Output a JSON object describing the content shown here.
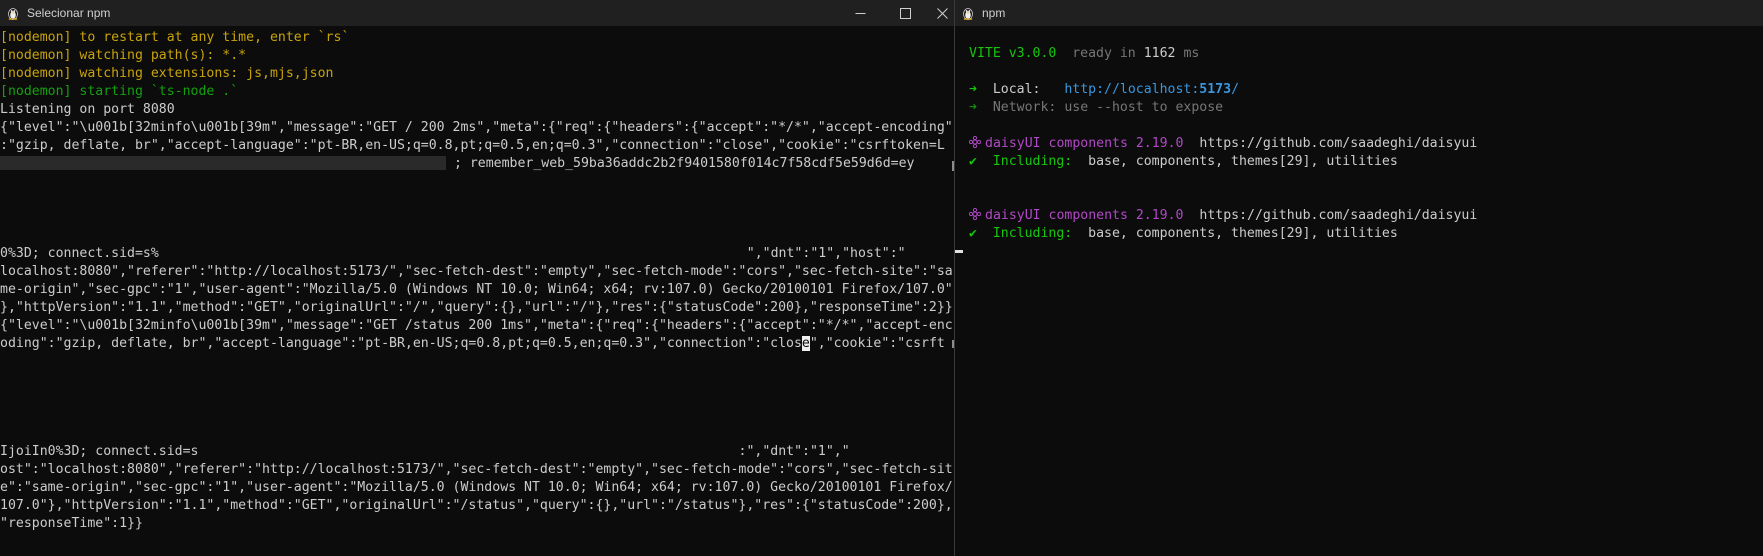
{
  "left_window": {
    "title": "Selecionar npm",
    "lines": [
      {
        "text": "[nodemon] to restart at any time, enter `rs`",
        "color": "yellow"
      },
      {
        "text": "[nodemon] watching path(s): *.*",
        "color": "yellow"
      },
      {
        "text": "[nodemon] watching extensions: js,mjs,json",
        "color": "yellow"
      },
      {
        "text": "[nodemon] starting `ts-node .`",
        "color": "green"
      },
      {
        "text": "Listening on port 8080",
        "color": "white"
      },
      {
        "text": "{\"level\":\"\\u001b[32minfo\\u001b[39m\",\"message\":\"GET / 200 2ms\",\"meta\":{\"req\":{\"headers\":{\"accept\":\"*/*\",\"accept-encoding\"",
        "color": "white"
      },
      {
        "text": ":\"gzip, deflate, br\",\"accept-language\":\"pt-BR,en-US;q=0.8,pt;q=0.5,en;q=0.3\",\"connection\":\"close\",\"cookie\":\"csrftoken=L",
        "color": "white"
      },
      {
        "text": "; remember_web_59ba36addc2b2f9401580f014c7f58cdf5e59d6d=ey",
        "color": "white",
        "redact_prefix": true
      },
      {
        "text": "",
        "color": "white"
      },
      {
        "text": "",
        "color": "white"
      },
      {
        "text": "",
        "color": "white"
      },
      {
        "text": "",
        "color": "white"
      },
      {
        "text": "0%3D; connect.sid=s%",
        "color": "white",
        "tail": "\",\"dnt\":\"1\",\"host\":\""
      },
      {
        "text": "localhost:8080\",\"referer\":\"http://localhost:5173/\",\"sec-fetch-dest\":\"empty\",\"sec-fetch-mode\":\"cors\",\"sec-fetch-site\":\"sa",
        "color": "white"
      },
      {
        "text": "me-origin\",\"sec-gpc\":\"1\",\"user-agent\":\"Mozilla/5.0 (Windows NT 10.0; Win64; x64; rv:107.0) Gecko/20100101 Firefox/107.0\"",
        "color": "white"
      },
      {
        "text": "},\"httpVersion\":\"1.1\",\"method\":\"GET\",\"originalUrl\":\"/\",\"query\":{},\"url\":\"/\"},\"res\":{\"statusCode\":200},\"responseTime\":2}}",
        "color": "white"
      },
      {
        "text": "{\"level\":\"\\u001b[32minfo\\u001b[39m\",\"message\":\"GET /status 200 1ms\",\"meta\":{\"req\":{\"headers\":{\"accept\":\"*/*\",\"accept-enc",
        "color": "white"
      },
      {
        "text": "oding\":\"gzip, deflate, br\",\"accept-language\":\"pt-BR,en-US;q=0.8,pt;q=0.5,en;q=0.3\",\"connection\":\"close\",\"cookie\":\"csrft",
        "color": "white",
        "cursor_after": "clos",
        "cursor_char": "e"
      },
      {
        "text": "",
        "color": "white"
      },
      {
        "text": "",
        "color": "white"
      },
      {
        "text": "",
        "color": "white"
      },
      {
        "text": "",
        "color": "white"
      },
      {
        "text": "",
        "color": "white"
      },
      {
        "text": "IjoiIn0%3D; connect.sid=s",
        "color": "white",
        "tail": ":\",\"dnt\":\"1\",\""
      },
      {
        "text": "ost\":\"localhost:8080\",\"referer\":\"http://localhost:5173/\",\"sec-fetch-dest\":\"empty\",\"sec-fetch-mode\":\"cors\",\"sec-fetch-sit",
        "color": "white"
      },
      {
        "text": "e\":\"same-origin\",\"sec-gpc\":\"1\",\"user-agent\":\"Mozilla/5.0 (Windows NT 10.0; Win64; x64; rv:107.0) Gecko/20100101 Firefox/",
        "color": "white"
      },
      {
        "text": "107.0\"},\"httpVersion\":\"1.1\",\"method\":\"GET\",\"originalUrl\":\"/status\",\"query\":{},\"url\":\"/status\"},\"res\":{\"statusCode\":200},",
        "color": "white"
      },
      {
        "text": "\"responseTime\":1}}",
        "color": "white"
      }
    ]
  },
  "right_window": {
    "title": "npm",
    "vite": {
      "name": "VITE v3.0.0",
      "ready": "ready in",
      "ms_value": "1162",
      "ms_unit": "ms"
    },
    "local": {
      "label": "Local:",
      "url_prefix": "http://localhost:",
      "port": "5173",
      "url_suffix": "/"
    },
    "network": {
      "label": "Network:",
      "text": "use --host to expose"
    },
    "daisy_blocks": [
      {
        "name": "daisyUI components 2.19.0",
        "url": "https://github.com/saadeghi/daisyui",
        "including_label": "Including:",
        "including": "base, components, themes[29], utilities"
      },
      {
        "name": "daisyUI components 2.19.0",
        "url": "https://github.com/saadeghi/daisyui",
        "including_label": "Including:",
        "including": "base, components, themes[29], utilities"
      }
    ]
  },
  "colors": {
    "background": "#0c0c0c",
    "titlebar": "#202020",
    "nodemon_yellow": "#c8a30a",
    "nodemon_green": "#13a10e",
    "vite_green": "#16c60c",
    "url_cyan": "#3a96dd",
    "daisy_purple": "#b148c6"
  },
  "icons": {
    "window_icon": "tux-penguin-icon",
    "minimize": "minimize-icon",
    "maximize": "maximize-icon",
    "close": "close-icon",
    "daisy": "flower-icon"
  }
}
